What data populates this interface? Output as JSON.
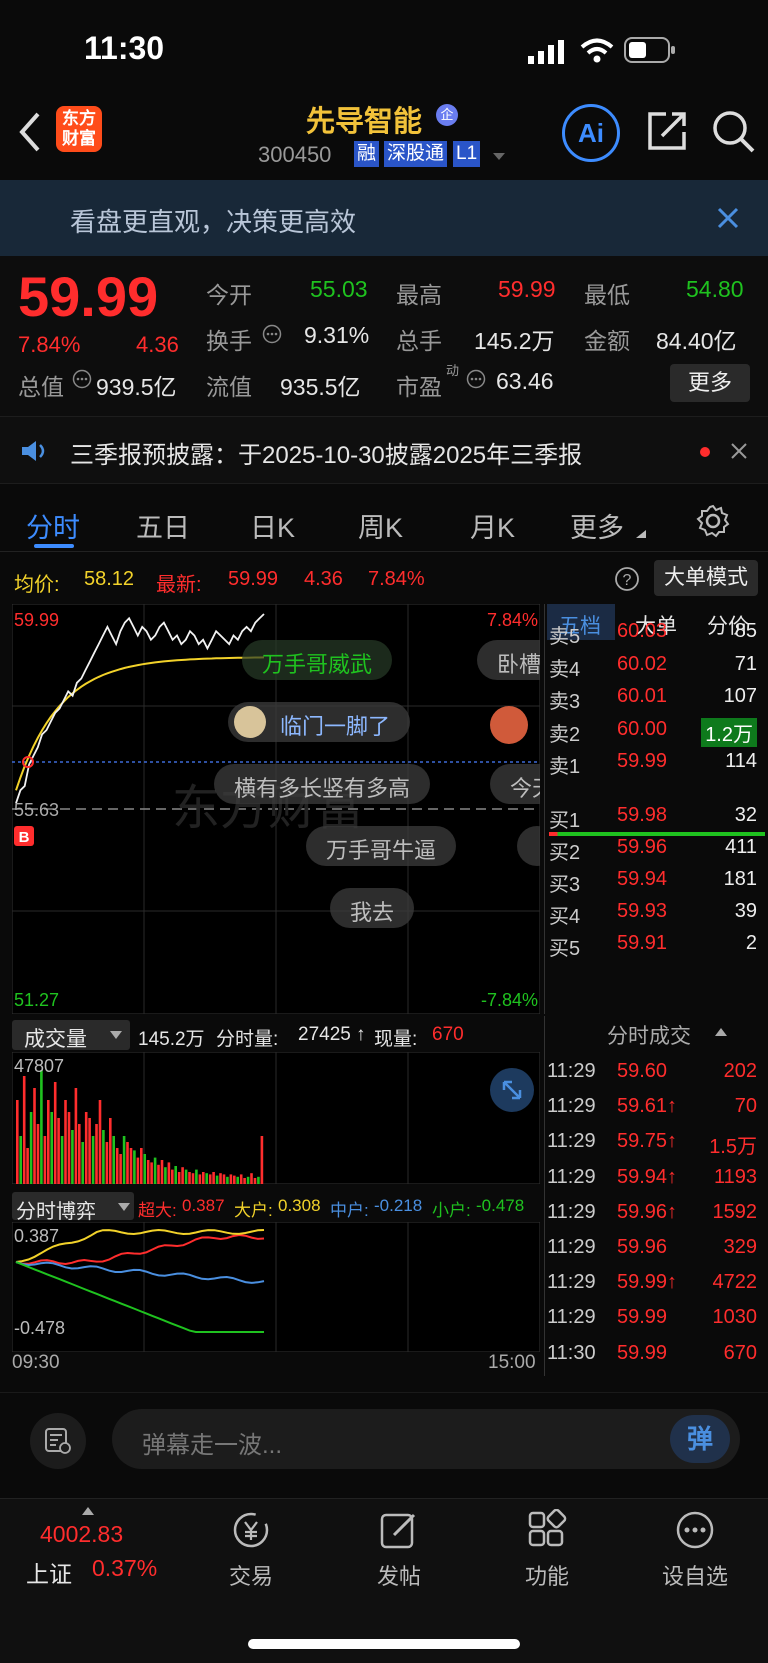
{
  "status": {
    "time": "11:30"
  },
  "header": {
    "logo_text": "东方财富",
    "stock_name": "先导智能",
    "stock_tag": "企",
    "stock_code": "300450",
    "badges": [
      "融",
      "深股通",
      "L1"
    ],
    "ai_label": "Ai"
  },
  "banner": {
    "text": "看盘更直观，决策更高效"
  },
  "quote": {
    "price": "59.99",
    "change_pct": "7.84%",
    "change": "4.36",
    "open_label": "今开",
    "open": "55.03",
    "high_label": "最高",
    "high": "59.99",
    "low_label": "最低",
    "low": "54.80",
    "turnover_label": "换手",
    "turnover": "9.31%",
    "volume_label": "总手",
    "volume": "145.2万",
    "amount_label": "金额",
    "amount": "84.40亿",
    "mcap_label": "总值",
    "mcap": "939.5亿",
    "float_label": "流值",
    "float_mcap": "935.5亿",
    "pe_label": "市盈",
    "pe_sup": "动",
    "pe": "63.46",
    "more_label": "更多"
  },
  "notice": {
    "text": "三季报预披露：于2025-10-30披露2025年三季报"
  },
  "tabs": [
    "分时",
    "五日",
    "日K",
    "周K",
    "月K",
    "更多"
  ],
  "active_tab": "分时",
  "chart_info": {
    "avg_label": "均价:",
    "avg": "58.12",
    "latest_label": "最新:",
    "latest": "59.99",
    "latest_chg": "4.36",
    "latest_pct": "7.84%",
    "mode_button": "大单模式"
  },
  "chart_labels": {
    "y_top": "59.99",
    "y_mid": "55.63",
    "y_bottom": "51.27",
    "pct_top": "7.84%",
    "pct_bottom": "-7.84%",
    "b_marker": "B"
  },
  "danmu": [
    "万手哥威武",
    "卧槽",
    "临门一脚了",
    "横有多长竖有多高",
    "今天",
    "万手哥牛逼",
    "我去"
  ],
  "volume_panel": {
    "label": "成交量",
    "total": "145.2万",
    "period_label": "分时量:",
    "period": "27425",
    "now_label": "现量:",
    "now": "670",
    "max": "47807"
  },
  "flow_panel": {
    "label": "分时博弈",
    "super_label": "超大:",
    "super": "0.387",
    "big_label": "大户:",
    "big": "0.308",
    "mid_label": "中户:",
    "mid": "-0.218",
    "small_label": "小户:",
    "small": "-0.478",
    "y_top": "0.387",
    "y_bottom": "-0.478",
    "x_start": "09:30",
    "x_end": "15:00"
  },
  "orderbook": {
    "tabs": [
      "五档",
      "大单",
      "分价"
    ],
    "asks": [
      {
        "label": "卖5",
        "price": "60.03",
        "vol": "85"
      },
      {
        "label": "卖4",
        "price": "60.02",
        "vol": "71"
      },
      {
        "label": "卖3",
        "price": "60.01",
        "vol": "107"
      },
      {
        "label": "卖2",
        "price": "60.00",
        "vol": "1.2万"
      },
      {
        "label": "卖1",
        "price": "59.99",
        "vol": "114"
      }
    ],
    "bids": [
      {
        "label": "买1",
        "price": "59.98",
        "vol": "32"
      },
      {
        "label": "买2",
        "price": "59.96",
        "vol": "411"
      },
      {
        "label": "买3",
        "price": "59.94",
        "vol": "181"
      },
      {
        "label": "买4",
        "price": "59.93",
        "vol": "39"
      },
      {
        "label": "买5",
        "price": "59.91",
        "vol": "2"
      }
    ]
  },
  "trades": {
    "title": "分时成交",
    "rows": [
      {
        "time": "11:29",
        "price": "59.60",
        "vol": "202",
        "vcolor": "red"
      },
      {
        "time": "11:29",
        "price": "59.61↑",
        "vol": "70",
        "vcolor": "red"
      },
      {
        "time": "11:29",
        "price": "59.75↑",
        "vol": "1.5万",
        "vcolor": "red"
      },
      {
        "time": "11:29",
        "price": "59.94↑",
        "vol": "1193",
        "vcolor": "red"
      },
      {
        "time": "11:29",
        "price": "59.96↑",
        "vol": "1592",
        "vcolor": "red"
      },
      {
        "time": "11:29",
        "price": "59.96",
        "vol": "329",
        "vcolor": "red"
      },
      {
        "time": "11:29",
        "price": "59.99↑",
        "vol": "4722",
        "vcolor": "red"
      },
      {
        "time": "11:29",
        "price": "59.99",
        "vol": "1030",
        "vcolor": "red"
      },
      {
        "time": "11:30",
        "price": "59.99",
        "vol": "670",
        "vcolor": "red"
      }
    ]
  },
  "comment": {
    "placeholder": "弹幕走一波...",
    "send_icon": "弹"
  },
  "bottom_nav": {
    "index_value": "4002.83",
    "index_name": "上证",
    "index_pct": "0.37%",
    "items": [
      "交易",
      "发帖",
      "功能",
      "设自选"
    ]
  },
  "colors": {
    "up": "#ff2d2d",
    "down": "#1fc21f",
    "avg": "#f2d22a",
    "accent": "#2f7de1"
  }
}
